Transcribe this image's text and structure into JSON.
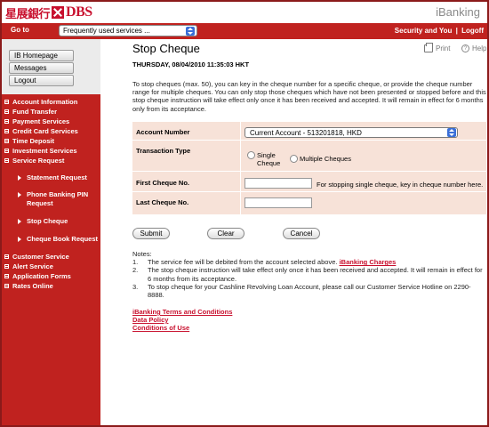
{
  "header": {
    "logo_cn": "星展銀行",
    "logo_en": "DBS",
    "app_name": "iBanking"
  },
  "navbar": {
    "goto_label": "Go to",
    "quick_select_value": "Frequently used services ...",
    "security_link": "Security and You",
    "separator": "|",
    "logoff_link": "Logoff"
  },
  "sidebar": {
    "buttons": [
      "IB Homepage",
      "Messages",
      "Logout"
    ],
    "menu": [
      "Account Information",
      "Fund Transfer",
      "Payment Services",
      "Credit Card Services",
      "Time Deposit",
      "Investment Services",
      "Service Request"
    ],
    "submenu": [
      "Statement Request",
      "Phone Banking PIN Request",
      "Stop Cheque",
      "Cheque Book Request"
    ],
    "menu2": [
      "Customer Service",
      "Alert Service",
      "Application Forms",
      "Rates Online"
    ]
  },
  "page": {
    "title": "Stop Cheque",
    "print_label": "Print",
    "help_label": "Help",
    "datetime": "THURSDAY, 08/04/2010 11:35:03 HKT",
    "intro": "To stop cheques (max. 50), you can key in the cheque number for a specific cheque, or provide the cheque number range for multiple cheques. You can only stop those cheques which have not been presented or stopped before and this stop cheque instruction will take effect only once it has been received and accepted. It will remain in effect for 6 months only from its acceptance."
  },
  "form": {
    "account_label": "Account Number",
    "account_value": "Current Account - 513201818, HKD",
    "transaction_label": "Transaction Type",
    "single_cheque": "Single Cheque",
    "multiple_cheques": "Multiple Cheques",
    "first_label": "First Cheque No.",
    "first_hint": "For stopping single cheque, key in cheque number here.",
    "last_label": "Last Cheque No."
  },
  "buttons": {
    "submit": "Submit",
    "clear": "Clear",
    "cancel": "Cancel"
  },
  "notes": {
    "heading": "Notes:",
    "n1_num": "1.",
    "n1_text": "The service fee will be debited from the account selected above.",
    "n1_link": "iBanking Charges",
    "n2_num": "2.",
    "n2_text": "The stop cheque instruction will take effect only once it has been received and accepted. It will remain in effect for 6 months from its acceptance.",
    "n3_num": "3.",
    "n3_text": "To stop cheque for your Cashline Revolving Loan Account, please call our Customer Service Hotline on 2290-8888."
  },
  "footer": {
    "links": [
      "iBanking Terms and Conditions",
      "Data Policy",
      "Conditions of Use"
    ]
  }
}
